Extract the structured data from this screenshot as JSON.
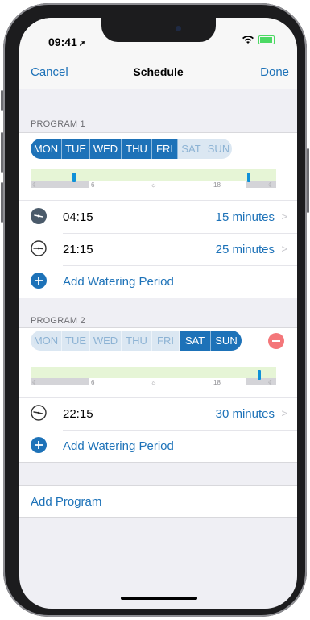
{
  "status": {
    "time": "09:41",
    "location_icon": "location-arrow-icon",
    "wifi_icon": "wifi-icon",
    "battery_icon": "battery-charging-icon"
  },
  "nav": {
    "cancel": "Cancel",
    "title": "Schedule",
    "done": "Done"
  },
  "programs": [
    {
      "header": "PROGRAM 1",
      "days": [
        {
          "label": "MON",
          "active": true
        },
        {
          "label": "TUE",
          "active": true
        },
        {
          "label": "WED",
          "active": true
        },
        {
          "label": "THU",
          "active": true
        },
        {
          "label": "FRI",
          "active": true
        },
        {
          "label": "SAT",
          "active": false
        },
        {
          "label": "SUN",
          "active": false
        }
      ],
      "timeline": {
        "ticks": [
          "6",
          "18"
        ],
        "markers_hours": [
          4.25,
          21.25
        ]
      },
      "periods": [
        {
          "time": "04:15",
          "duration": "15 minutes",
          "icon": "night-clock-icon"
        },
        {
          "time": "21:15",
          "duration": "25 minutes",
          "icon": "clock-icon"
        }
      ],
      "add_label": "Add Watering Period"
    },
    {
      "header": "PROGRAM 2",
      "days": [
        {
          "label": "MON",
          "active": false
        },
        {
          "label": "TUE",
          "active": false
        },
        {
          "label": "WED",
          "active": false
        },
        {
          "label": "THU",
          "active": false
        },
        {
          "label": "FRI",
          "active": false
        },
        {
          "label": "SAT",
          "active": true
        },
        {
          "label": "SUN",
          "active": true
        }
      ],
      "timeline": {
        "ticks": [
          "6",
          "18"
        ],
        "markers_hours": [
          22.25
        ]
      },
      "periods": [
        {
          "time": "22:15",
          "duration": "30 minutes",
          "icon": "clock-icon"
        }
      ],
      "add_label": "Add Watering Period"
    }
  ],
  "add_program": "Add Program",
  "colors": {
    "accent": "#1d72b8",
    "day_inactive": "#dbe7f2",
    "daylight": "#e6f5d6",
    "remove": "#f4777a",
    "marker": "#0f91d8"
  }
}
